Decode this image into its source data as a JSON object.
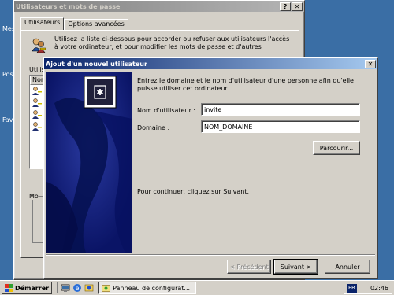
{
  "desktop": {
    "labels": [
      "Mes",
      "Pos",
      "Fav"
    ]
  },
  "back_window": {
    "title": "Utilisateurs et mots de passe",
    "help_btn": "?",
    "close_btn": "✕",
    "tabs": [
      {
        "label": "Utilisateurs",
        "active": true
      },
      {
        "label": "Options avancées",
        "active": false
      }
    ],
    "intro_text": "Utilisez la liste ci-dessous pour accorder ou refuser aux utilisateurs l'accès à votre ordinateur, et pour modifier les mots de passe et d'autres",
    "users_label": "Utilis",
    "list_header": "Nor",
    "mo_label": "Mo"
  },
  "wizard": {
    "title": "Ajout d'un nouvel utilisateur",
    "close_btn": "✕",
    "instructions": "Entrez le domaine et le nom d'utilisateur d'une personne afin qu'elle puisse utiliser cet ordinateur.",
    "username_label": "Nom d'utilisateur :",
    "username_value": "invite",
    "domain_label": "Domaine :",
    "domain_value": "NOM_DOMAINE",
    "browse_btn": "Parcourir...",
    "continue_text": "Pour continuer, cliquez sur Suivant.",
    "prev_btn": "< Précédent",
    "next_btn": "Suivant >",
    "cancel_btn": "Annuler"
  },
  "taskbar": {
    "start_label": "Démarrer",
    "task_label": "Panneau de configurat...",
    "lang": "FR",
    "clock": "02:46"
  },
  "colors": {
    "desktop": "#3a6ea5",
    "active_title_start": "#0a246a",
    "wizard_side": "#0a1a6e"
  },
  "icons": [
    "users-key-icon",
    "user-icon",
    "wizard-key-icon",
    "windows-flag-icon",
    "desktop-icon",
    "ie-icon",
    "outlook-icon",
    "control-panel-icon"
  ]
}
